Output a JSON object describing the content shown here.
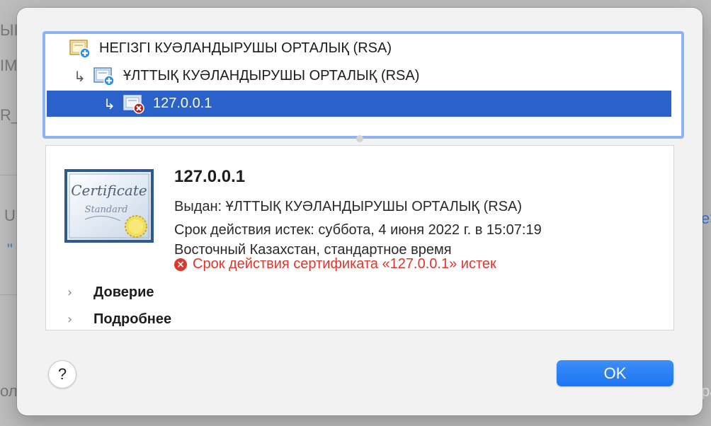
{
  "background_fragments": [
    "ЫI",
    "IM",
    "R_",
    "U",
    "\"",
    "e>",
    "ол",
    "pa"
  ],
  "chain": {
    "items": [
      {
        "label": "НЕГІЗГІ КУӘЛАНДЫРУШЫ ОРТАЛЫҚ (RSA)",
        "icon": "root-certificate-icon",
        "selected": false
      },
      {
        "label": "ҰЛТТЫҚ КУӘЛАНДЫРУШЫ ОРТАЛЫҚ (RSA)",
        "icon": "intermediate-certificate-icon",
        "selected": false
      },
      {
        "label": "127.0.0.1",
        "icon": "invalid-certificate-icon",
        "selected": true
      }
    ],
    "arrow": "↳"
  },
  "details": {
    "certificate_image": {
      "line1": "Certificate",
      "line2": "Standard"
    },
    "title": "127.0.0.1",
    "issued_by": "Выдан: ҰЛТТЫҚ КУӘЛАНДЫРУШЫ ОРТАЛЫҚ (RSA)",
    "expiry": "Срок действия истек: суббота, 4 июня 2022 г. в 15:07:19",
    "timezone": "Восточный Казахстан, стандартное время",
    "error": "Срок действия сертификата «127.0.0.1» истек",
    "trust_label": "Доверие",
    "more_label": "Подробнее",
    "chevron": "›"
  },
  "buttons": {
    "help": "?",
    "ok": "OK"
  },
  "colors": {
    "selection": "#2a62c9",
    "error": "#e0352b",
    "accent": "#1b74f0",
    "focus_ring": "#8fb2f2"
  }
}
